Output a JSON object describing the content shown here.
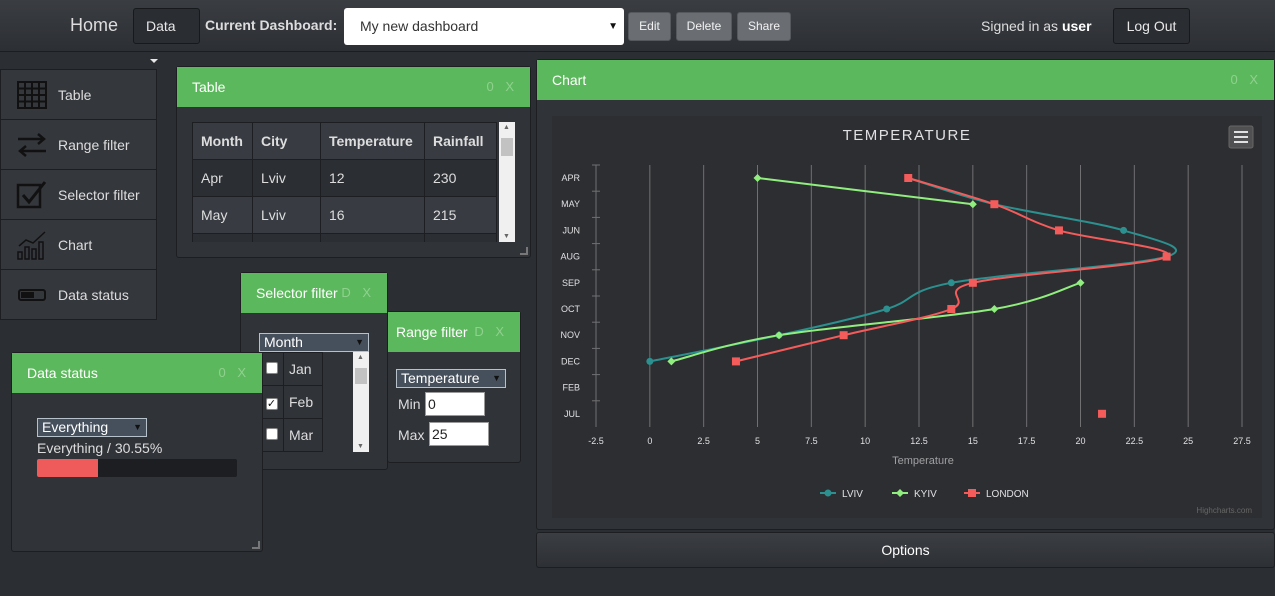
{
  "nav": {
    "home": "Home",
    "data_menu": "Data",
    "current_dashboard_label": "Current Dashboard:",
    "dashboard_value": "My new dashboard",
    "edit": "Edit",
    "delete": "Delete",
    "share": "Share",
    "signed_prefix": "Signed in as",
    "user": "user",
    "logout": "Log Out"
  },
  "sidebar": {
    "items": [
      {
        "label": "Table",
        "icon": "table-icon"
      },
      {
        "label": "Range filter",
        "icon": "range-arrows-icon"
      },
      {
        "label": "Selector filter",
        "icon": "checkbox-icon"
      },
      {
        "label": "Chart",
        "icon": "bar-chart-icon"
      },
      {
        "label": "Data status",
        "icon": "progress-bar-icon"
      }
    ]
  },
  "table_widget": {
    "title": "Table",
    "controls": "0 X",
    "columns": [
      "Month",
      "City",
      "Temperature",
      "Rainfall"
    ],
    "rows": [
      [
        "Apr",
        "Lviv",
        "12",
        "230"
      ],
      [
        "May",
        "Lviv",
        "16",
        "215"
      ]
    ]
  },
  "selector_widget": {
    "title": "Selector filter",
    "controls": "D X",
    "field": "Month",
    "options": [
      {
        "label": "Jan",
        "checked": false
      },
      {
        "label": "Feb",
        "checked": true
      },
      {
        "label": "Mar",
        "checked": false
      }
    ]
  },
  "range_widget": {
    "title": "Range filter",
    "controls": "D X",
    "field": "Temperature",
    "min_label": "Min",
    "min_value": "0",
    "max_label": "Max",
    "max_value": "25"
  },
  "status_widget": {
    "title": "Data status",
    "controls": "0 X",
    "select": "Everything",
    "status_text": "Everything / 30.55%",
    "progress": 0.3055,
    "progress_color": "#ef5a5a"
  },
  "chart_widget": {
    "title": "Chart",
    "controls": "0 X",
    "menu_icon": "hamburger-icon",
    "credit": "Highcharts.com"
  },
  "chart_data": {
    "type": "line",
    "title": "Temperature",
    "xlabel": "Temperature",
    "ylabel": "",
    "xlim": [
      -2.5,
      27.5
    ],
    "x_ticks": [
      "-2.5",
      "0",
      "2.5",
      "5",
      "7.5",
      "10",
      "12.5",
      "15",
      "17.5",
      "20",
      "22.5",
      "25",
      "27.5"
    ],
    "categories": [
      "Apr",
      "May",
      "Jun",
      "Aug",
      "Sep",
      "Oct",
      "Nov",
      "Dec",
      "Feb",
      "Jul"
    ],
    "grid": true,
    "legend": "bottom-center",
    "series": [
      {
        "name": "Lviv",
        "color": "#2b908f",
        "marker": "circle",
        "points": [
          [
            12,
            "Apr"
          ],
          [
            16,
            "May"
          ],
          [
            22,
            "Jun"
          ],
          [
            24,
            "Aug"
          ],
          [
            14,
            "Sep"
          ],
          [
            11,
            "Oct"
          ],
          [
            6,
            "Nov"
          ],
          [
            0,
            "Dec"
          ]
        ]
      },
      {
        "name": "Kyiv",
        "color": "#90ee7e",
        "marker": "diamond",
        "points": [
          [
            5,
            "Apr"
          ],
          [
            15,
            "May"
          ],
          [
            20,
            "Sep"
          ],
          [
            16,
            "Oct"
          ],
          [
            6,
            "Nov"
          ],
          [
            1,
            "Dec"
          ]
        ]
      },
      {
        "name": "London",
        "color": "#f45b5b",
        "marker": "square",
        "points": [
          [
            12,
            "Apr"
          ],
          [
            16,
            "May"
          ],
          [
            19,
            "Jun"
          ],
          [
            24,
            "Aug"
          ],
          [
            15,
            "Sep"
          ],
          [
            14,
            "Oct"
          ],
          [
            9,
            "Nov"
          ],
          [
            4,
            "Dec"
          ],
          [
            21,
            "Jul"
          ]
        ]
      }
    ]
  },
  "options_label": "Options"
}
